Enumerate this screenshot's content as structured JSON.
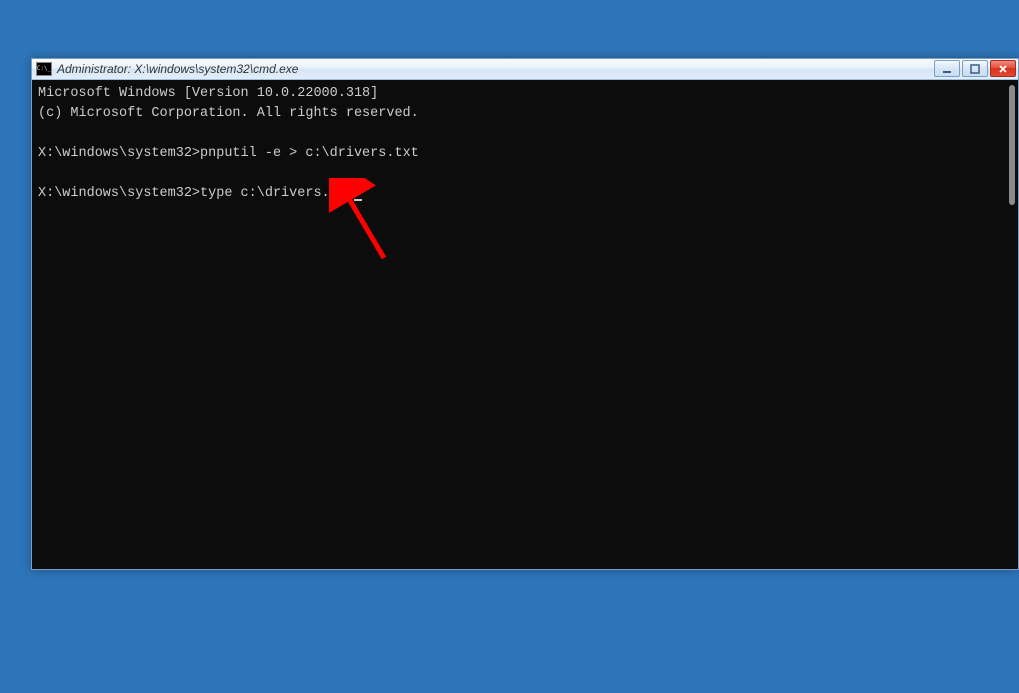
{
  "window": {
    "title": "Administrator: X:\\windows\\system32\\cmd.exe"
  },
  "terminal": {
    "line1": "Microsoft Windows [Version 10.0.22000.318]",
    "line2": "(c) Microsoft Corporation. All rights reserved.",
    "blank1": "",
    "prompt1_path": "X:\\windows\\system32>",
    "prompt1_cmd": "pnputil -e > c:\\drivers.txt",
    "blank2": "",
    "prompt2_path": "X:\\windows\\system32>",
    "prompt2_cmd": "type c:\\drivers.txt"
  },
  "controls": {
    "minimize": "minimize",
    "maximize": "maximize",
    "close": "close"
  }
}
